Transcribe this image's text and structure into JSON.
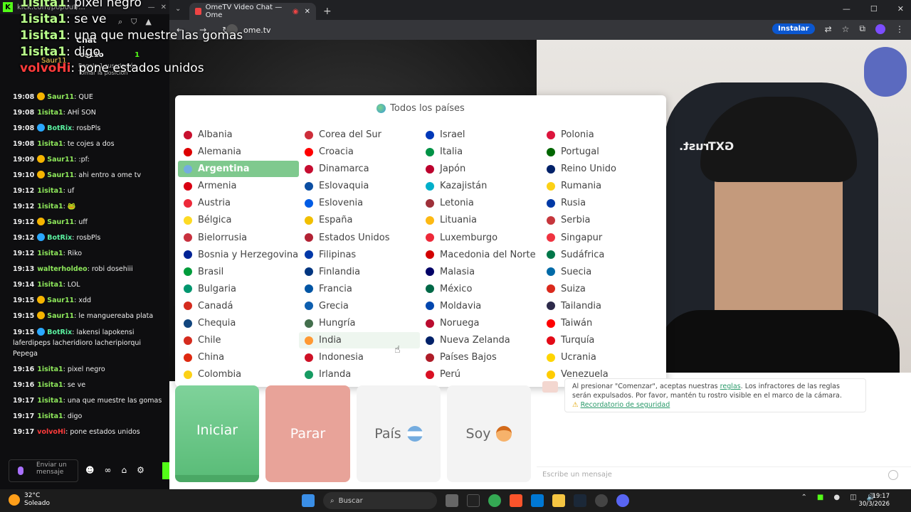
{
  "chat_app": {
    "url_hint": "kick.com/popout/...",
    "header_title": "Chat",
    "sub_user": "os11o",
    "sub_count": "1",
    "sub_note_line1": "Regala 1 suscripción",
    "sub_note_line2": "Tomar la posición",
    "pinned_user": "Saur11",
    "input_placeholder": "Enviar un mensaje",
    "messages": [
      {
        "time": "19:08",
        "user": "Saur11",
        "color": "#8ee85b",
        "badge": "#f5b400",
        "text": "QUE"
      },
      {
        "time": "19:08",
        "user": "1isita1",
        "color": "#8ee85b",
        "badge": "",
        "text": "AHÍ SON"
      },
      {
        "time": "19:08",
        "user": "BotRix",
        "color": "#5af0a0",
        "badge": "#2aa8ff",
        "text": "rosbPls"
      },
      {
        "time": "19:08",
        "user": "1isita1",
        "color": "#8ee85b",
        "badge": "",
        "text": "te cojes a dos"
      },
      {
        "time": "19:09",
        "user": "Saur11",
        "color": "#8ee85b",
        "badge": "#f5b400",
        "text": ":pf:"
      },
      {
        "time": "19:10",
        "user": "Saur11",
        "color": "#8ee85b",
        "badge": "#f5b400",
        "text": "ahi entro a ome tv"
      },
      {
        "time": "19:12",
        "user": "1isita1",
        "color": "#8ee85b",
        "badge": "",
        "text": "uf"
      },
      {
        "time": "19:12",
        "user": "1isita1",
        "color": "#8ee85b",
        "badge": "",
        "text": "🐸"
      },
      {
        "time": "19:12",
        "user": "Saur11",
        "color": "#8ee85b",
        "badge": "#f5b400",
        "text": "uff"
      },
      {
        "time": "19:12",
        "user": "BotRix",
        "color": "#5af0a0",
        "badge": "#2aa8ff",
        "text": "rosbPls"
      },
      {
        "time": "19:12",
        "user": "1isita1",
        "color": "#8ee85b",
        "badge": "",
        "text": "Riko"
      },
      {
        "time": "19:13",
        "user": "walterholdeo",
        "color": "#8ee85b",
        "badge": "",
        "text": "robi dosehiii"
      },
      {
        "time": "19:14",
        "user": "1isita1",
        "color": "#8ee85b",
        "badge": "",
        "text": "LOL"
      },
      {
        "time": "19:15",
        "user": "Saur11",
        "color": "#8ee85b",
        "badge": "#f5b400",
        "text": "xdd"
      },
      {
        "time": "19:15",
        "user": "Saur11",
        "color": "#8ee85b",
        "badge": "#f5b400",
        "text": "le manguereaba plata"
      },
      {
        "time": "19:15",
        "user": "BotRix",
        "color": "#5af0a0",
        "badge": "#2aa8ff",
        "text": "lakensi lapokensi laferdipeps lacheridioro lacheripiorqui Pepega",
        "multi": true
      },
      {
        "time": "19:16",
        "user": "1isita1",
        "color": "#8ee85b",
        "badge": "",
        "text": "pixel negro"
      },
      {
        "time": "19:16",
        "user": "1isita1",
        "color": "#8ee85b",
        "badge": "",
        "text": "se ve"
      },
      {
        "time": "19:17",
        "user": "1isita1",
        "color": "#8ee85b",
        "badge": "",
        "text": "una que muestre las gomas"
      },
      {
        "time": "19:17",
        "user": "1isita1",
        "color": "#8ee85b",
        "badge": "",
        "text": "digo"
      },
      {
        "time": "19:17",
        "user": "volvoHi",
        "color": "#ff3b3b",
        "badge": "",
        "text": "pone estados unidos"
      }
    ]
  },
  "overlay": [
    {
      "user": "1isita1",
      "text": "pixel negro",
      "red": false
    },
    {
      "user": "1isita1",
      "text": "se ve",
      "red": false
    },
    {
      "user": "1isita1",
      "text": "una que muestre las gomas",
      "red": false
    },
    {
      "user": "1isita1",
      "text": "digo",
      "red": false
    },
    {
      "user": "volvoHi",
      "text": "pone estados unidos",
      "red": true
    }
  ],
  "browser": {
    "tab_title": "OmeTV Video Chat — Ome",
    "url": "ome.tv",
    "install_label": "Instalar"
  },
  "ometv": {
    "panel_title": "Todos los países",
    "countries": [
      {
        "name": "Albania",
        "flag": "#c8102e"
      },
      {
        "name": "Alemania",
        "flag": "#dd0000"
      },
      {
        "name": "Argentina",
        "flag": "#74acdf",
        "selected": true
      },
      {
        "name": "Armenia",
        "flag": "#d90012"
      },
      {
        "name": "Austria",
        "flag": "#ed2939"
      },
      {
        "name": "Bélgica",
        "flag": "#fdda24"
      },
      {
        "name": "Bielorrusia",
        "flag": "#c8313e"
      },
      {
        "name": "Bosnia y Herzegovina",
        "flag": "#002395"
      },
      {
        "name": "Brasil",
        "flag": "#009c3b"
      },
      {
        "name": "Bulgaria",
        "flag": "#00966e"
      },
      {
        "name": "Canadá",
        "flag": "#d52b1e"
      },
      {
        "name": "Chequia",
        "flag": "#11457e"
      },
      {
        "name": "Chile",
        "flag": "#d52b1e"
      },
      {
        "name": "China",
        "flag": "#de2910"
      },
      {
        "name": "Colombia",
        "flag": "#fcd116"
      },
      {
        "name": "Corea del Sur",
        "flag": "#cd2e3a"
      },
      {
        "name": "Croacia",
        "flag": "#ff0000"
      },
      {
        "name": "Dinamarca",
        "flag": "#c60c30"
      },
      {
        "name": "Eslovaquia",
        "flag": "#0b4ea2"
      },
      {
        "name": "Eslovenia",
        "flag": "#005ce5"
      },
      {
        "name": "España",
        "flag": "#f1bf00"
      },
      {
        "name": "Estados Unidos",
        "flag": "#b22234"
      },
      {
        "name": "Filipinas",
        "flag": "#0038a8"
      },
      {
        "name": "Finlandia",
        "flag": "#003580"
      },
      {
        "name": "Francia",
        "flag": "#0055a4"
      },
      {
        "name": "Grecia",
        "flag": "#0d5eaf"
      },
      {
        "name": "Hungría",
        "flag": "#436f4d"
      },
      {
        "name": "India",
        "flag": "#ff9933",
        "hover": true
      },
      {
        "name": "Indonesia",
        "flag": "#ce1126"
      },
      {
        "name": "Irlanda",
        "flag": "#169b62"
      },
      {
        "name": "Israel",
        "flag": "#0038b8"
      },
      {
        "name": "Italia",
        "flag": "#009246"
      },
      {
        "name": "Japón",
        "flag": "#bc002d"
      },
      {
        "name": "Kazajistán",
        "flag": "#00afca"
      },
      {
        "name": "Letonia",
        "flag": "#9e3039"
      },
      {
        "name": "Lituania",
        "flag": "#fdb913"
      },
      {
        "name": "Luxemburgo",
        "flag": "#ed2939"
      },
      {
        "name": "Macedonia del Norte",
        "flag": "#d20000"
      },
      {
        "name": "Malasia",
        "flag": "#010066"
      },
      {
        "name": "México",
        "flag": "#006847"
      },
      {
        "name": "Moldavia",
        "flag": "#0046ae"
      },
      {
        "name": "Noruega",
        "flag": "#ba0c2f"
      },
      {
        "name": "Nueva Zelanda",
        "flag": "#012169"
      },
      {
        "name": "Países Bajos",
        "flag": "#ae1c28"
      },
      {
        "name": "Perú",
        "flag": "#d91023"
      },
      {
        "name": "Polonia",
        "flag": "#dc143c"
      },
      {
        "name": "Portugal",
        "flag": "#006600"
      },
      {
        "name": "Reino Unido",
        "flag": "#012169"
      },
      {
        "name": "Rumania",
        "flag": "#fcd116"
      },
      {
        "name": "Rusia",
        "flag": "#0039a6"
      },
      {
        "name": "Serbia",
        "flag": "#c6363c"
      },
      {
        "name": "Singapur",
        "flag": "#ef3340"
      },
      {
        "name": "Sudáfrica",
        "flag": "#007749"
      },
      {
        "name": "Suecia",
        "flag": "#006aa7"
      },
      {
        "name": "Suiza",
        "flag": "#da291c"
      },
      {
        "name": "Tailandia",
        "flag": "#2d2a4a"
      },
      {
        "name": "Taiwán",
        "flag": "#fe0000"
      },
      {
        "name": "Turquía",
        "flag": "#e30a17"
      },
      {
        "name": "Ucrania",
        "flag": "#ffd500"
      },
      {
        "name": "Venezuela",
        "flag": "#ffcc00"
      }
    ],
    "buttons": {
      "start": "Iniciar",
      "stop": "Parar",
      "country": "País",
      "gender": "Soy"
    },
    "rules": {
      "line1": "Al presionar \"Comenzar\", aceptas nuestras",
      "link": "reglas",
      "line2": ". Los infractores de las reglas serán expulsados. Por favor, mantén tu rostro visible en el marco de la cámara.",
      "safety_link": "Recordatorio de seguridad"
    },
    "message_placeholder": "Escribe un mensaje",
    "cam_logo": "GXTrust."
  },
  "taskbar": {
    "temp": "32°C",
    "weather": "Soleado",
    "search": "Buscar",
    "time": "19:17",
    "date": "30/3/2026"
  }
}
